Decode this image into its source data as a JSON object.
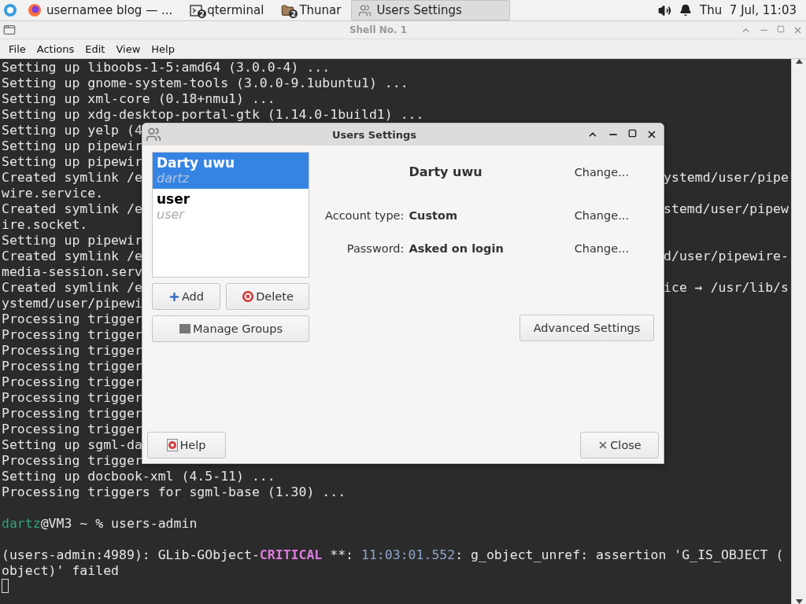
{
  "taskbar": {
    "items": [
      {
        "label": "usernamee blog — ...",
        "selected": false
      },
      {
        "label": "qterminal",
        "badge": "2",
        "selected": false
      },
      {
        "label": "Thunar",
        "badge": "2",
        "selected": false
      },
      {
        "label": "Users Settings",
        "selected": true
      }
    ],
    "clock": "Thu  7 Jul, 11:03"
  },
  "terminal": {
    "title": "Shell No. 1",
    "menu": [
      "File",
      "Actions",
      "Edit",
      "View",
      "Help"
    ],
    "rows": [
      {
        "segments": [
          {
            "text": "Setting up liboobs-1-5:amd64 (3.0.0-4) ...",
            "kind": "plain"
          }
        ]
      },
      {
        "segments": [
          {
            "text": "Setting up gnome-system-tools (3.0.0-9.1ubuntu1) ...",
            "kind": "plain"
          }
        ]
      },
      {
        "segments": [
          {
            "text": "Setting up xml-core (0.18+nmu1) ...",
            "kind": "plain"
          }
        ]
      },
      {
        "segments": [
          {
            "text": "Setting up xdg-desktop-portal-gtk (1.14.0-1build1) ...",
            "kind": "plain"
          }
        ]
      },
      {
        "segments": [
          {
            "text": "Setting up yelp (4",
            "kind": "plain"
          }
        ]
      },
      {
        "segments": [
          {
            "text": "Setting up pipewir",
            "kind": "plain"
          }
        ]
      },
      {
        "segments": [
          {
            "text": "Setting up pipewir",
            "kind": "plain"
          }
        ]
      },
      {
        "segments": [
          {
            "text": "Created symlink /e",
            "kind": "plain"
          }
        ],
        "right": "ystemd/user/pipe"
      },
      {
        "segments": [
          {
            "text": "wire.service.",
            "kind": "plain"
          }
        ]
      },
      {
        "segments": [
          {
            "text": "Created symlink /e",
            "kind": "plain"
          }
        ],
        "right": "stemd/user/pipew"
      },
      {
        "segments": [
          {
            "text": "ire.socket.",
            "kind": "plain"
          }
        ]
      },
      {
        "segments": [
          {
            "text": "Setting up pipewir",
            "kind": "plain"
          }
        ]
      },
      {
        "segments": [
          {
            "text": "Created symlink /e",
            "kind": "plain"
          }
        ],
        "right": "d/user/pipewire-"
      },
      {
        "segments": [
          {
            "text": "media-session.serv",
            "kind": "plain"
          }
        ]
      },
      {
        "segments": [
          {
            "text": "Created symlink /e",
            "kind": "plain"
          }
        ],
        "right": "ice → /usr/lib/s"
      },
      {
        "segments": [
          {
            "text": "ystemd/user/pipewi",
            "kind": "plain"
          }
        ]
      },
      {
        "segments": [
          {
            "text": "Processing trigger",
            "kind": "plain"
          }
        ]
      },
      {
        "segments": [
          {
            "text": "Processing trigger",
            "kind": "plain"
          }
        ]
      },
      {
        "segments": [
          {
            "text": "Processing trigger",
            "kind": "plain"
          }
        ]
      },
      {
        "segments": [
          {
            "text": "Processing trigger",
            "kind": "plain"
          }
        ]
      },
      {
        "segments": [
          {
            "text": "Processing trigger",
            "kind": "plain"
          }
        ]
      },
      {
        "segments": [
          {
            "text": "Processing trigger",
            "kind": "plain"
          }
        ]
      },
      {
        "segments": [
          {
            "text": "Processing trigger",
            "kind": "plain"
          }
        ]
      },
      {
        "segments": [
          {
            "text": "Processing trigger",
            "kind": "plain"
          }
        ]
      },
      {
        "segments": [
          {
            "text": "Setting up sgml-da",
            "kind": "plain"
          }
        ]
      },
      {
        "segments": [
          {
            "text": "Processing trigger",
            "kind": "plain"
          }
        ]
      },
      {
        "segments": [
          {
            "text": "Setting up docbook-xml (4.5-11) ...",
            "kind": "plain"
          }
        ]
      },
      {
        "segments": [
          {
            "text": "Processing triggers for sgml-base (1.30) ...",
            "kind": "plain"
          }
        ]
      },
      {
        "segments": []
      },
      {
        "segments": [
          {
            "text": "dartz",
            "kind": "user"
          },
          {
            "text": "@VM3 ~ % users-admin",
            "kind": "plain"
          }
        ]
      },
      {
        "segments": []
      },
      {
        "segments": [
          {
            "text": "(users-admin:4989): GLib-GObject-",
            "kind": "plain"
          },
          {
            "text": "CRITICAL",
            "kind": "error"
          },
          {
            "text": " **: ",
            "kind": "plain"
          },
          {
            "text": "11:03:01.552",
            "kind": "timestamp"
          },
          {
            "text": ": g_object_unref: assertion 'G_IS_OBJECT (",
            "kind": "plain"
          }
        ]
      },
      {
        "segments": [
          {
            "text": "object)' failed",
            "kind": "plain"
          }
        ]
      }
    ]
  },
  "dialog": {
    "title": "Users Settings",
    "users": [
      {
        "name": "Darty uwu",
        "login": "dartz",
        "selected": true
      },
      {
        "name": "user",
        "login": "user",
        "selected": false
      }
    ],
    "add_button": "Add",
    "delete_button": "Delete",
    "manage_groups_button": "Manage Groups",
    "fields": [
      {
        "value": "Darty uwu",
        "action": "Change..."
      },
      {
        "label": "Account type:",
        "value": "Custom",
        "action": "Change..."
      },
      {
        "label": "Password:",
        "value": "Asked on login",
        "action": "Change..."
      }
    ],
    "advanced_button": "Advanced Settings",
    "help_button": "Help",
    "close_button": "Close"
  }
}
